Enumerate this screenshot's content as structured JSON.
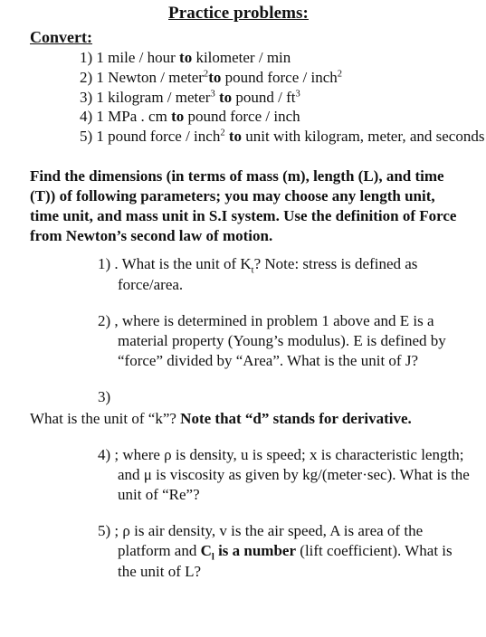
{
  "document": {
    "title": "Practice problems:",
    "sections": {
      "convert": {
        "heading": "Convert:",
        "items": [
          {
            "num": "1)",
            "pre": "1 mile / hour ",
            "bold": "to",
            "post": " kilometer / min"
          },
          {
            "num": "2)",
            "pre": "1 Newton / meter",
            "pre_sup": "2",
            "bold": "to",
            "post": " pound force / inch",
            "post_sup": "2"
          },
          {
            "num": "3)",
            "pre": "1 kilogram / meter",
            "pre_sup": "3",
            "bold": "to",
            "post": " pound / ft",
            "post_sup": "3"
          },
          {
            "num": "4)",
            "pre": "1 MPa . cm ",
            "bold": "to",
            "post": " pound force / inch"
          },
          {
            "num": "5)",
            "pre": "1 pound force / inch",
            "pre_sup": "2",
            "bold": "to",
            "post": " unit with kilogram, meter, and seconds"
          }
        ]
      },
      "dimensions": {
        "instructions": "Find the dimensions (in terms of mass (m), length (L), and time (T)) of following parameters; you may choose any length unit, time unit, and mass unit in S.I system.  Use the definition of Force from Newton’s second law of motion.",
        "questions": [
          {
            "num": "1)",
            "text_a": " .  What is the unit of K",
            "sub": "t",
            "text_b": "? Note: stress is defined as force/area."
          },
          {
            "num": "2)",
            "text_a": " , where is determined in problem 1 above and E is a material property (Young’s modulus).  E is defined by “force” divided by “Area”.  What is the unit of J?"
          },
          {
            "num": "3)",
            "text_a": "",
            "follow_plain": "What is the unit of “k”? ",
            "follow_bold": "Note that “d” stands for derivative."
          },
          {
            "num": "4)",
            "text_a": " ; where ρ is density, u is speed; x is characteristic length; and μ is viscosity as given by kg/(meter·sec).  What is the unit of “Re”?"
          },
          {
            "num": "5)",
            "text_a": " ;  ρ is air density, v is the air speed, A is area of the platform and ",
            "bold_c": "C",
            "bold_c_sub": "l",
            "bold_rest": " is a number",
            "text_b": " (lift coefficient).  What is the unit of L?"
          }
        ]
      }
    }
  }
}
